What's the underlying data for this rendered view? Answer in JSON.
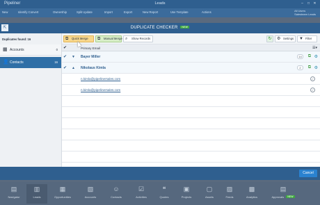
{
  "app": {
    "brand": "Pipeliner",
    "title": "Leads",
    "toolbar": [
      "New",
      "Identify Convert",
      "Ownership",
      "Split Update",
      "Import",
      "Export",
      "New Report",
      "Use Template",
      "Actions"
    ],
    "user_line1": "All Users",
    "user_line2": "Salesteam Leads"
  },
  "dialog": {
    "title": "DUPLICATE CHECKER",
    "badge": "NEW",
    "duplicates_found_label": "Duplicates found: 16",
    "sidebar": [
      {
        "label": "Accounts",
        "count": "0",
        "icon": "building-icon"
      },
      {
        "label": "Contacts",
        "count": "16",
        "icon": "person-icon"
      }
    ],
    "toolbar": {
      "quick_merge": "Quick Merge",
      "manual_merge": "Manual Merge",
      "show_records": "Show Records",
      "settings": "Settings",
      "filter": "Filter"
    },
    "grid": {
      "column": "Primary Email",
      "groups": [
        {
          "name": "Bayer Miller",
          "count": "14",
          "expanded": false
        },
        {
          "name": "Nikolaus Kimla",
          "count": "2",
          "expanded": true,
          "rows": [
            "n.kimla@pipelinersales.com",
            "n.kimla@pipelinersales.com"
          ]
        }
      ]
    },
    "cancel": "Cancel"
  },
  "nav": {
    "items": [
      "Navigator",
      "Leads",
      "Opportunities",
      "Accounts",
      "Contacts",
      "Activities",
      "Quotes",
      "Projects",
      "Assets",
      "Feeds",
      "Analytics",
      "Approvals"
    ],
    "active": "Leads",
    "approvals_badge": "NEW"
  },
  "colors": {
    "header": "#2f5f8f",
    "selected": "#2f6fa6",
    "quick_merge": "#f8d78c",
    "manual_merge": "#d8eec8",
    "cancel": "#2a82d0"
  }
}
